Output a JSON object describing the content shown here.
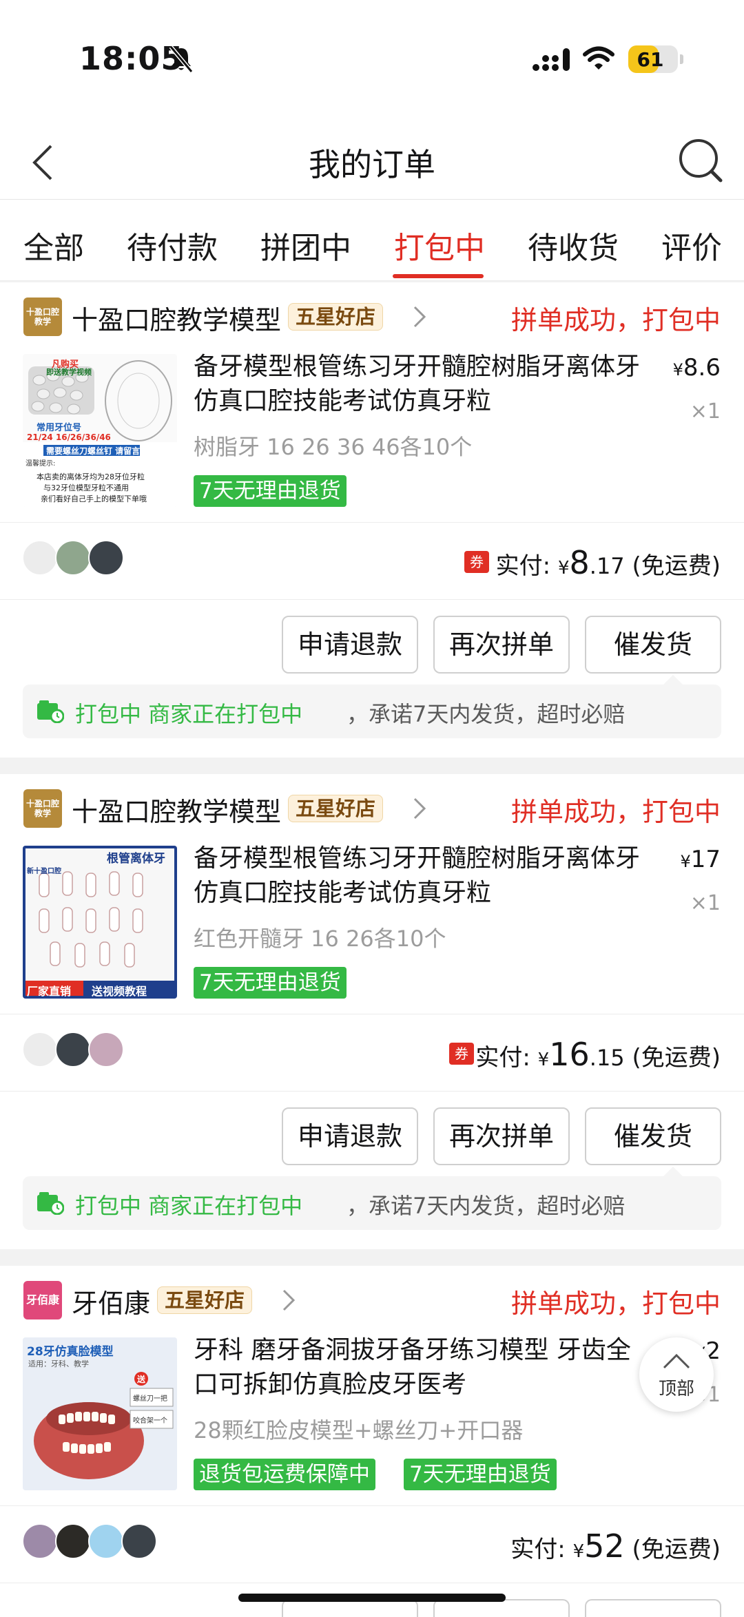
{
  "status_bar": {
    "time": "18:05",
    "battery": "61",
    "battery_level": 0.61
  },
  "nav": {
    "title": "我的订单"
  },
  "tabs": [
    {
      "label": "全部"
    },
    {
      "label": "待付款"
    },
    {
      "label": "拼团中"
    },
    {
      "label": "打包中",
      "active": true
    },
    {
      "label": "待收货"
    },
    {
      "label": "评价"
    }
  ],
  "orders": [
    {
      "shop_logo_text": "十盈口腔教学",
      "shop_name": "十盈口腔教学模型",
      "shop_badge": "五星好店",
      "status": "拼单成功，打包中",
      "thumb_texts": [
        "凡购买",
        "即送教学视频",
        "常用牙位号",
        "21/24   16/26/36/46",
        "需要螺丝刀螺丝钉 请留言",
        "温馨提示:",
        "本店卖的离体牙均为28牙位牙粒",
        "与32牙位模型牙粒不通用",
        "亲们看好自己手上的模型下单哦"
      ],
      "title": "备牙模型根管练习牙开髓腔树脂牙离体牙仿真口腔技能考试仿真牙粒",
      "price": "8.6",
      "qty": "×1",
      "spec": "树脂牙 16 26 36 46各10个",
      "tags": [
        "7天无理由退货"
      ],
      "paid_label": "实付:",
      "paid_amount_int": "8",
      "paid_amount_dec": ".17",
      "shipping": "(免运费)",
      "coupon": "券",
      "buttons": [
        "申请退款",
        "再次拼单",
        "催发货"
      ],
      "notice_status": "打包中 商家正在打包中",
      "notice_text": "，承诺7天内发货，超时必赔"
    },
    {
      "shop_logo_text": "十盈口腔教学",
      "shop_name": "十盈口腔教学模型",
      "shop_badge": "五星好店",
      "status": "拼单成功，打包中",
      "thumb_texts": [
        "新十盈口腔",
        "根管离体牙",
        "厂家直销",
        "送视频教程"
      ],
      "title": "备牙模型根管练习牙开髓腔树脂牙离体牙仿真口腔技能考试仿真牙粒",
      "price": "17",
      "qty": "×1",
      "spec": "红色开髓牙 16 26各10个",
      "tags": [
        "7天无理由退货"
      ],
      "paid_label": "实付:",
      "paid_amount_int": "16",
      "paid_amount_dec": ".15",
      "shipping": "(免运费)",
      "coupon": "券",
      "buttons": [
        "申请退款",
        "再次拼单",
        "催发货"
      ],
      "notice_status": "打包中 商家正在打包中",
      "notice_text": "，承诺7天内发货，超时必赔"
    },
    {
      "shop_logo_text": "牙佰康",
      "shop_name": "牙佰康",
      "shop_badge": "五星好店",
      "status": "拼单成功，打包中",
      "thumb_texts": [
        "28牙仿真脸模型",
        "适用：牙科、教学",
        "送",
        "螺丝刀一把",
        "咬合架一个"
      ],
      "title": "牙科 磨牙备洞拔牙备牙练习模型 牙齿全口可拆卸仿真脸皮牙医考",
      "price": "2",
      "qty": "×1",
      "spec": "28颗红脸皮模型+螺丝刀+开口器",
      "tags": [
        "退货包运费保障中",
        "7天无理由退货"
      ],
      "paid_label": "实付:",
      "paid_amount_int": "52",
      "paid_amount_dec": "",
      "shipping": "(免运费)"
    }
  ],
  "back_to_top": "顶部",
  "colors": {
    "accent": "#e02e24",
    "green": "#34b944",
    "badge_bg": "#fdf1dc"
  }
}
